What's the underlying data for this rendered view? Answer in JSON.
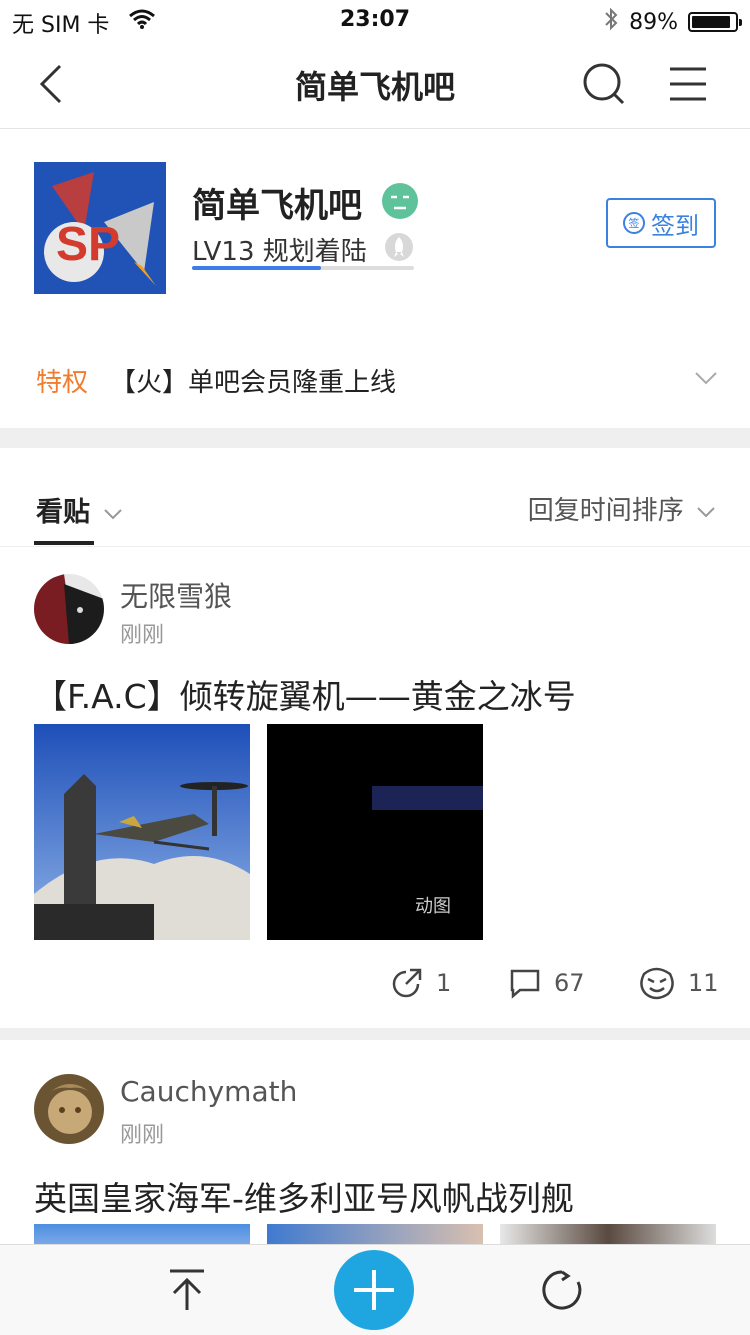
{
  "status_bar": {
    "carrier": "无 SIM 卡",
    "time": "23:07",
    "battery": "89%"
  },
  "nav": {
    "title": "简单飞机吧"
  },
  "forum": {
    "name": "简单飞机吧",
    "level": "LV13 规划着陆",
    "level_progress": 0.58,
    "signin_label": "签到",
    "signin_icon_text": "签"
  },
  "privilege": {
    "label": "特权",
    "text": "【火】单吧会员隆重上线"
  },
  "tabs": {
    "browse_label": "看贴",
    "sort_label": "回复时间排序"
  },
  "posts": [
    {
      "author": "无限雪狼",
      "time": "刚刚",
      "title": "【F.A.C】倾转旋翼机——黄金之冰号",
      "gif_badge": "动图",
      "shares": "1",
      "comments": "67",
      "likes": "11"
    },
    {
      "author": "Cauchymath",
      "time": "刚刚",
      "title": "英国皇家海军-维多利亚号风帆战列舰"
    }
  ],
  "colors": {
    "accent_blue": "#3a82e0",
    "privilege_orange": "#f27c2e",
    "fab_blue": "#1fa6e0"
  }
}
